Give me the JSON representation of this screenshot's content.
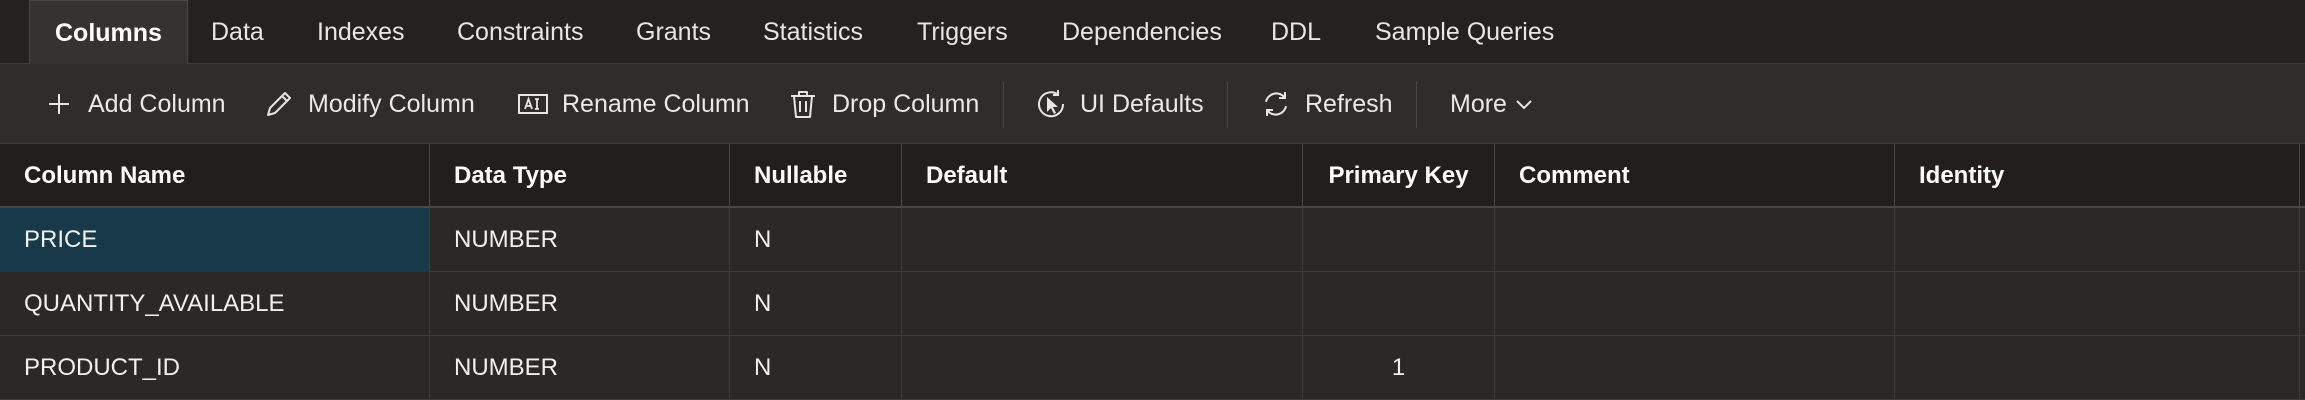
{
  "tabs": [
    {
      "label": "Columns",
      "active": true
    },
    {
      "label": "Data"
    },
    {
      "label": "Indexes"
    },
    {
      "label": "Constraints"
    },
    {
      "label": "Grants"
    },
    {
      "label": "Statistics"
    },
    {
      "label": "Triggers"
    },
    {
      "label": "Dependencies"
    },
    {
      "label": "DDL"
    },
    {
      "label": "Sample Queries"
    }
  ],
  "toolbar": {
    "add_column": "Add Column",
    "modify_column": "Modify Column",
    "rename_column": "Rename Column",
    "drop_column": "Drop Column",
    "ui_defaults": "UI Defaults",
    "refresh": "Refresh",
    "more": "More"
  },
  "icons": {
    "add": "plus-icon",
    "modify": "pencil-icon",
    "rename": "rename-field-icon",
    "drop": "trash-icon",
    "ui_defaults": "cursor-refresh-icon",
    "refresh": "refresh-icon",
    "more": "chevron-down-icon"
  },
  "colors": {
    "selection": "#17394a",
    "header_bg": "#211e1c",
    "tabbar_bg": "#24211f",
    "toolbar_bg": "#2f2c2a",
    "grid_bg": "#2b2826"
  },
  "table": {
    "columns": [
      "Column Name",
      "Data Type",
      "Nullable",
      "Default",
      "Primary Key",
      "Comment",
      "Identity"
    ],
    "rows": [
      [
        "PRICE",
        "NUMBER",
        "N",
        "",
        "",
        "",
        ""
      ],
      [
        "QUANTITY_AVAILABLE",
        "NUMBER",
        "N",
        "",
        "",
        "",
        ""
      ],
      [
        "PRODUCT_ID",
        "NUMBER",
        "N",
        "",
        "1",
        "",
        ""
      ]
    ]
  }
}
